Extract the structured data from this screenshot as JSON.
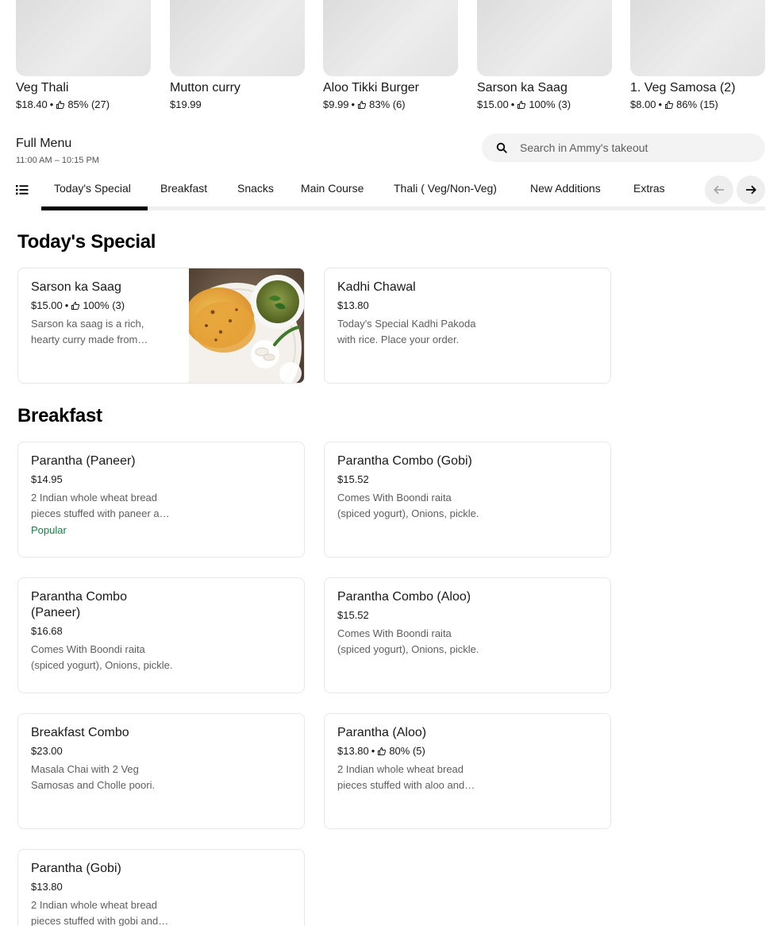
{
  "featured": [
    {
      "name": "Veg Thali",
      "price": "$18.40",
      "rating": "85% (27)"
    },
    {
      "name": "Mutton curry",
      "price": "$19.99",
      "rating": ""
    },
    {
      "name": "Aloo Tikki Burger",
      "price": "$9.99",
      "rating": "83% (6)"
    },
    {
      "name": "Sarson ka Saag",
      "price": "$15.00",
      "rating": "100% (3)"
    },
    {
      "name": "1. Veg Samosa (2)",
      "price": "$8.00",
      "rating": "86% (15)"
    }
  ],
  "menu": {
    "title": "Full Menu",
    "hours": "11:00 AM – 10:15 PM"
  },
  "search": {
    "placeholder": "Search in Ammy's takeout"
  },
  "tabs": [
    {
      "label": "Today's Special",
      "active": true
    },
    {
      "label": "Breakfast"
    },
    {
      "label": "Snacks"
    },
    {
      "label": "Main Course"
    },
    {
      "label": "Thali ( Veg/Non-Veg)"
    },
    {
      "label": "New Additions"
    },
    {
      "label": "Extras"
    }
  ],
  "sections": [
    {
      "title": "Today's Special",
      "items": [
        {
          "name": "Sarson ka Saag",
          "price": "$15.00",
          "rating": "100% (3)",
          "desc": "Sarson ka saag is a rich, hearty curry made from mustard greens.",
          "has_image": true
        },
        {
          "name": "Kadhi Chawal",
          "price": "$13.80",
          "desc": "Today's Special Kadhi Pakoda with rice. Place your order."
        }
      ]
    },
    {
      "title": "Breakfast",
      "items": [
        {
          "name": "Parantha (Paneer)",
          "price": "$14.95",
          "desc": "2 Indian whole wheat bread pieces stuffed with paneer and spices.",
          "badge": "Popular"
        },
        {
          "name": "Parantha Combo (Gobi)",
          "price": "$15.52",
          "desc": "Comes With Boondi raita (spiced yogurt), Onions, pickle."
        },
        {
          "name": "Parantha Combo (Paneer)",
          "price": "$16.68",
          "desc": "Comes With Boondi raita (spiced yogurt), Onions, pickle."
        },
        {
          "name": "Parantha Combo (Aloo)",
          "price": "$15.52",
          "desc": "Comes With Boondi raita (spiced yogurt), Onions, pickle."
        },
        {
          "name": "Breakfast Combo",
          "price": "$23.00",
          "desc": "Masala Chai with 2 Veg Samosas and Cholle poori."
        },
        {
          "name": "Parantha (Aloo)",
          "price": "$13.80",
          "rating": "80% (5)",
          "desc": "2 Indian whole wheat bread pieces stuffed with aloo and spices."
        },
        {
          "name": "Parantha (Gobi)",
          "price": "$13.80",
          "desc": "2 Indian whole wheat bread pieces stuffed with gobi and spices."
        }
      ]
    }
  ],
  "colors": {
    "accent": "#000000",
    "popular": "#0e8345",
    "search_bg": "#f3f3f3"
  }
}
